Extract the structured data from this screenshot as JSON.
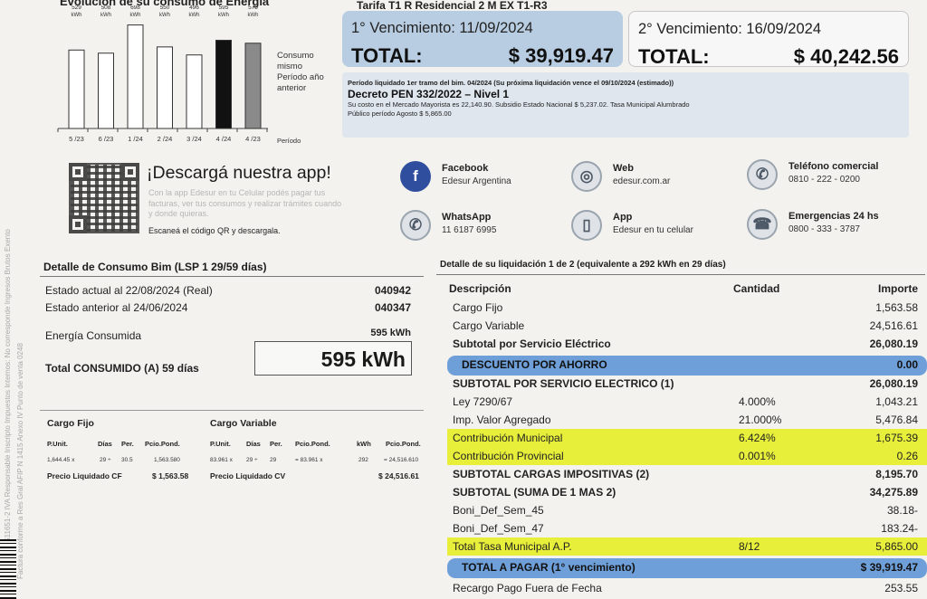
{
  "side": {
    "text1": "CUIT 30-65511651-2 IVA Responsable Inscripto Impuestos Internos: No corresponde Ingresos Brutos Exento",
    "text2": "Factura conforme a Res Gral AFIP N 1415 Anexo IV Punto de venta 0248"
  },
  "chart_data": {
    "type": "bar",
    "title": "Evolución de su consumo de Energía",
    "categories": [
      "5 /23",
      "6 /23",
      "1 /24",
      "2 /24",
      "3 /24",
      "4 /24",
      "4 /23"
    ],
    "values": [
      529,
      508,
      698,
      550,
      496,
      595,
      575
    ],
    "value_labels": [
      "529",
      "508",
      "698",
      "550",
      "496",
      "595",
      "575"
    ],
    "unit_label": "kWh",
    "highlight_index": 5,
    "highlight_color": "#111111",
    "reference_index": 6,
    "reference_color": "#8a8a8a",
    "bar_color": "#ffffff",
    "side_label": "Consumo mismo Período año anterior",
    "xlabel": "Período"
  },
  "header": {
    "tarifa": "Tarifa T1 R Residencial 2 M EX T1-R3",
    "venc1_date": "1° Vencimiento: 11/09/2024",
    "venc1_total_label": "TOTAL:",
    "venc1_total": "$  39,919.47",
    "venc2_date": "2° Vencimiento: 16/09/2024",
    "venc2_total_label": "TOTAL:",
    "venc2_total": "$ 40,242.56",
    "info_line1": "Período liquidado 1er tramo del bim. 04/2024 (Su próxima liquidación vence el 09/10/2024 (estimado))",
    "info_line2": "Decreto PEN 332/2022 – Nivel 1",
    "info_line3": "Su costo en el Mercado Mayorista es 22,140.90. Subsidio Estado Nacional $ 5,237.02. Tasa Municipal Alumbrado",
    "info_line4": "Público período Agosto $ 5,865.00"
  },
  "app": {
    "title": "¡Descargá nuestra app!",
    "desc": "Con la app Edesur en tu Celular podés pagar tus facturas, ver tus consumos y realizar trámites cuando y donde quieras.",
    "scan": "Escaneá el código QR y descargala."
  },
  "contacts": [
    {
      "title": "Facebook",
      "value": "Edesur Argentina",
      "icon": "f",
      "color": "#2f4f9e"
    },
    {
      "title": "Web",
      "value": "edesur.com.ar",
      "icon": "◎",
      "color": "#6b7b8c"
    },
    {
      "title": "Teléfono comercial",
      "value": "0810 - 222 - 0200",
      "icon": "✆",
      "color": "#6b7b8c"
    },
    {
      "title": "WhatsApp",
      "value": "11 6187 6995",
      "icon": "✆",
      "color": "#6b7b8c"
    },
    {
      "title": "App",
      "value": "Edesur en tu celular",
      "icon": "▯",
      "color": "#6b7b8c"
    },
    {
      "title": "Emergencias 24 hs",
      "value": "0800 - 333 - 3787",
      "icon": "☎",
      "color": "#6b7b8c"
    }
  ],
  "consumo": {
    "heading": "Detalle de Consumo Bim (LSP 1 29/59 días)",
    "estado_actual_label": "Estado actual al 22/08/2024 (Real)",
    "estado_actual_value": "040942",
    "estado_anterior_label": "Estado anterior al 24/06/2024",
    "estado_anterior_value": "040347",
    "energia_label": "Energía Consumida",
    "energia_value": "595 kWh",
    "total_label": "Total CONSUMIDO (A) 59  días",
    "total_value": "595 kWh"
  },
  "cargos": {
    "fijo_heading": "Cargo Fijo",
    "variable_heading": "Cargo Variable",
    "fijo_cols": [
      "P.Unit.",
      "Días",
      "Per.",
      "Pcio.Pond."
    ],
    "fijo_vals": [
      "1,644.45 x",
      "29 ÷",
      "30.5",
      "1,563.580"
    ],
    "variable_cols": [
      "P.Unit.",
      "Días",
      "Per.",
      "Pcio.Pond.",
      "kWh",
      "Pcio.Pond."
    ],
    "variable_vals": [
      "83.961 x",
      "29 ÷",
      "29",
      "= 83.961 x",
      "292",
      "= 24,516.610"
    ],
    "precio_cf_label": "Precio Liquidado CF",
    "precio_cf_value": "$ 1,563.58",
    "precio_cv_label": "Precio Liquidado CV",
    "precio_cv_value": "$ 24,516.61"
  },
  "liquidacion": {
    "heading": "Detalle de su liquidación 1 de 2 (equivalente a 292 kWh en 29 días)",
    "col_desc": "Descripción",
    "col_cant": "Cantidad",
    "col_imp": "Importe",
    "rows": [
      {
        "desc": "Cargo Fijo",
        "cant": "",
        "imp": "1,563.58",
        "style": ""
      },
      {
        "desc": "Cargo Variable",
        "cant": "",
        "imp": "24,516.61",
        "style": ""
      },
      {
        "desc": "Subtotal por Servicio Eléctrico",
        "cant": "",
        "imp": "26,080.19",
        "style": "b"
      },
      {
        "desc": "DESCUENTO POR AHORRO",
        "cant": "",
        "imp": "0.00",
        "style": "blue"
      },
      {
        "desc": "SUBTOTAL POR SERVICIO ELECTRICO (1)",
        "cant": "",
        "imp": "26,080.19",
        "style": "b"
      },
      {
        "desc": "Ley 7290/67",
        "cant": "4.000%",
        "imp": "1,043.21",
        "style": ""
      },
      {
        "desc": "Imp. Valor Agregado",
        "cant": "21.000%",
        "imp": "5,476.84",
        "style": ""
      },
      {
        "desc": "Contribución Municipal",
        "cant": "6.424%",
        "imp": "1,675.39",
        "style": "yellow"
      },
      {
        "desc": "Contribución Provincial",
        "cant": "0.001%",
        "imp": "0.26",
        "style": "yellow"
      },
      {
        "desc": "SUBTOTAL CARGAS IMPOSITIVAS (2)",
        "cant": "",
        "imp": "8,195.70",
        "style": "b"
      },
      {
        "desc": "SUBTOTAL (SUMA DE 1 MAS 2)",
        "cant": "",
        "imp": "34,275.89",
        "style": "b"
      },
      {
        "desc": "Boni_Def_Sem_45",
        "cant": "",
        "imp": "38.18-",
        "style": ""
      },
      {
        "desc": "Boni_Def_Sem_47",
        "cant": "",
        "imp": "183.24-",
        "style": ""
      },
      {
        "desc": "Total Tasa Municipal A.P.",
        "cant": "8/12",
        "imp": "5,865.00",
        "style": "yellow"
      },
      {
        "desc": "TOTAL A PAGAR (1° vencimiento)",
        "cant": "",
        "imp": "$ 39,919.47",
        "style": "blue"
      },
      {
        "desc": "Recargo Pago Fuera de Fecha",
        "cant": "",
        "imp": "253.55",
        "style": ""
      }
    ]
  }
}
